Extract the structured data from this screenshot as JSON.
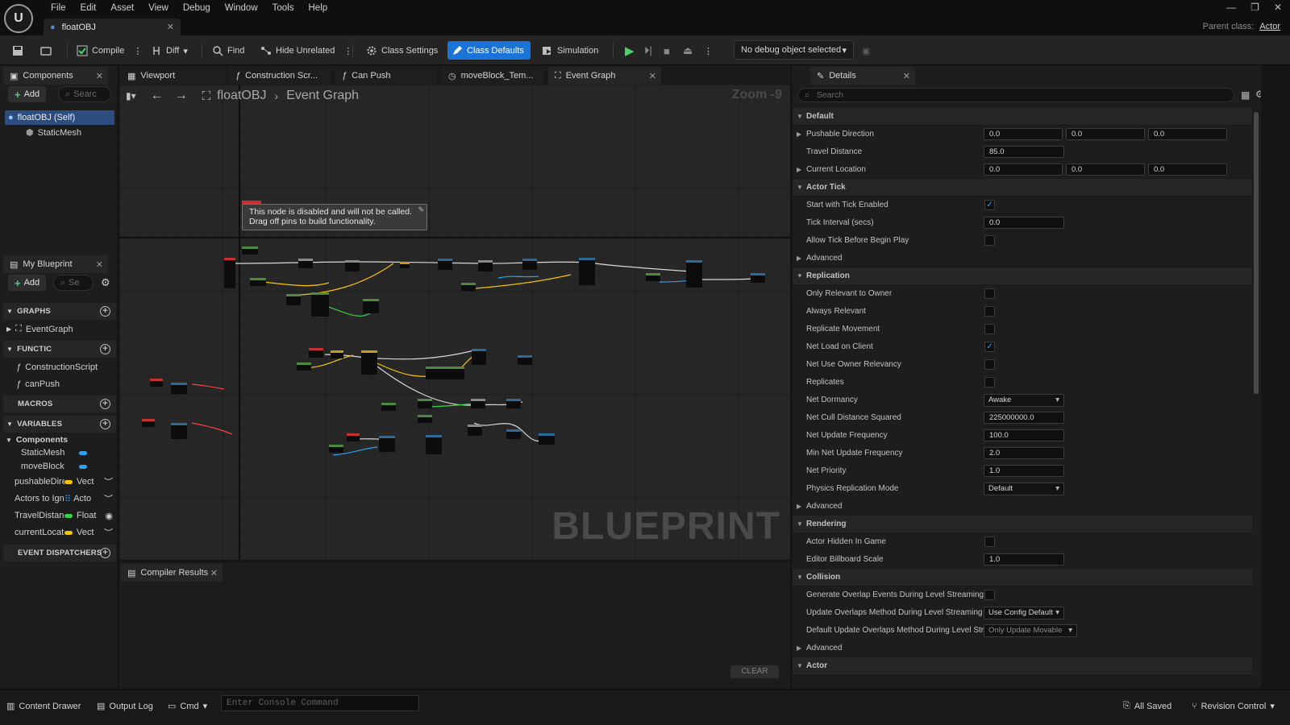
{
  "window": {
    "doc_tab": "floatOBJ",
    "parent_class_label": "Parent class:",
    "parent_class_value": "Actor"
  },
  "menu": [
    "File",
    "Edit",
    "Asset",
    "View",
    "Debug",
    "Window",
    "Tools",
    "Help"
  ],
  "toolbar": {
    "compile": "Compile",
    "diff": "Diff",
    "find": "Find",
    "hide_unrelated": "Hide Unrelated",
    "class_settings": "Class Settings",
    "class_defaults": "Class Defaults",
    "simulation": "Simulation",
    "debug_object": "No debug object selected"
  },
  "components_panel": {
    "title": "Components",
    "add": "Add",
    "search_placeholder": "Searc",
    "root": "floatOBJ (Self)",
    "child": "StaticMesh"
  },
  "editor_tabs": [
    "Viewport",
    "Construction Scr...",
    "Can Push",
    "moveBlock_Tem...",
    "Event Graph"
  ],
  "graph": {
    "crumb_root": "floatOBJ",
    "crumb_leaf": "Event Graph",
    "zoom": "Zoom -9",
    "watermark": "BLUEPRINT",
    "tooltip_line1": "This node is disabled and will not be called.",
    "tooltip_line2": "Drag off pins to build functionality."
  },
  "my_blueprint": {
    "title": "My Blueprint",
    "add": "Add",
    "search_placeholder": "Se",
    "sections": {
      "graphs": "GRAPHS",
      "functions": "FUNCTIC",
      "macros": "MACROS",
      "variables": "VARIABLES",
      "dispatchers": "EVENT DISPATCHERS"
    },
    "graphs": [
      "EventGraph"
    ],
    "functions": [
      "ConstructionScript",
      "canPush"
    ],
    "components_header": "Components",
    "component_vars": [
      "StaticMesh",
      "moveBlock"
    ],
    "variables": [
      {
        "name": "pushableDire",
        "type": "Vect",
        "color": "#f7c300"
      },
      {
        "name": "Actors to Ign",
        "type": "Acto",
        "color": "#2a9cf4"
      },
      {
        "name": "TravelDistan",
        "type": "Float",
        "color": "#38d046"
      },
      {
        "name": "currentLocat",
        "type": "Vect",
        "color": "#f7c300"
      }
    ]
  },
  "compiler": {
    "title": "Compiler Results",
    "clear": "CLEAR"
  },
  "details": {
    "title": "Details",
    "search_placeholder": "Search",
    "rows": {
      "cat_default": "Default",
      "pushable_direction": "Pushable Direction",
      "pushable_direction_vals": [
        "0.0",
        "0.0",
        "0.0"
      ],
      "travel_distance": "Travel Distance",
      "travel_distance_val": "85.0",
      "current_location": "Current Location",
      "current_location_vals": [
        "0.0",
        "0.0",
        "0.0"
      ],
      "cat_actor_tick": "Actor Tick",
      "start_tick": "Start with Tick Enabled",
      "tick_interval": "Tick Interval (secs)",
      "tick_interval_val": "0.0",
      "allow_tick": "Allow Tick Before Begin Play",
      "advanced": "Advanced",
      "cat_replication": "Replication",
      "only_relevant": "Only Relevant to Owner",
      "always_relevant": "Always Relevant",
      "replicate_movement": "Replicate Movement",
      "net_load": "Net Load on Client",
      "net_use_owner": "Net Use Owner Relevancy",
      "replicates": "Replicates",
      "net_dormancy": "Net Dormancy",
      "net_dormancy_val": "Awake",
      "net_cull": "Net Cull Distance Squared",
      "net_cull_val": "225000000.0",
      "net_update": "Net Update Frequency",
      "net_update_val": "100.0",
      "min_net_update": "Min Net Update Frequency",
      "min_net_update_val": "2.0",
      "net_priority": "Net Priority",
      "net_priority_val": "1.0",
      "physics_rep": "Physics Replication Mode",
      "physics_rep_val": "Default",
      "cat_rendering": "Rendering",
      "actor_hidden": "Actor Hidden In Game",
      "billboard": "Editor Billboard Scale",
      "billboard_val": "1.0",
      "cat_collision": "Collision",
      "gen_overlap": "Generate Overlap Events During Level Streaming",
      "update_overlap": "Update Overlaps Method During Level Streaming",
      "update_overlap_val": "Use Config Default",
      "default_update_overlap": "Default Update Overlaps Method During Level Str...",
      "default_update_overlap_val": "Only Update Movable",
      "cat_actor": "Actor"
    }
  },
  "statusbar": {
    "content_drawer": "Content Drawer",
    "output_log": "Output Log",
    "cmd": "Cmd",
    "console_placeholder": "Enter Console Command",
    "all_saved": "All Saved",
    "revision_control": "Revision Control"
  }
}
